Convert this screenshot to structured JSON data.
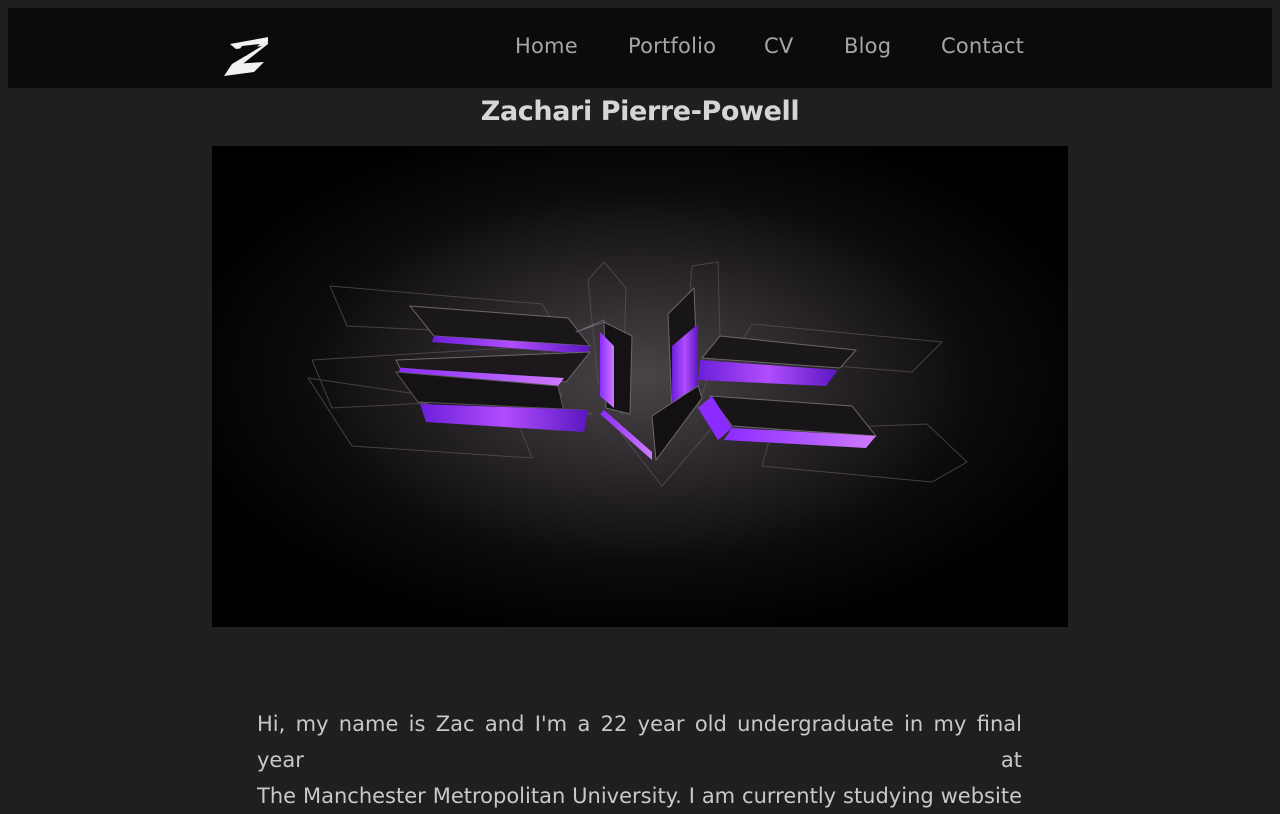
{
  "nav": {
    "logo_icon": "z-logo-icon",
    "links": [
      {
        "label": "Home"
      },
      {
        "label": "Portfolio"
      },
      {
        "label": "CV"
      },
      {
        "label": "Blog"
      },
      {
        "label": "Contact"
      }
    ]
  },
  "header": {
    "title": "Zachari Pierre-Powell"
  },
  "hero": {
    "image_icon": "zpp-3d-logo-banner",
    "accent_color": "#9b30ff"
  },
  "content": {
    "intro_lines": [
      "Hi, my name is Zac and I'm a 22 year old undergraduate in my final year at",
      "The Manchester Metropolitan University. I am currently studying website"
    ]
  },
  "colors": {
    "background": "#1f1f1f",
    "navbar": "#0b0b0b",
    "nav_text": "#a6a6a6",
    "title_text": "#d6d6d6"
  }
}
